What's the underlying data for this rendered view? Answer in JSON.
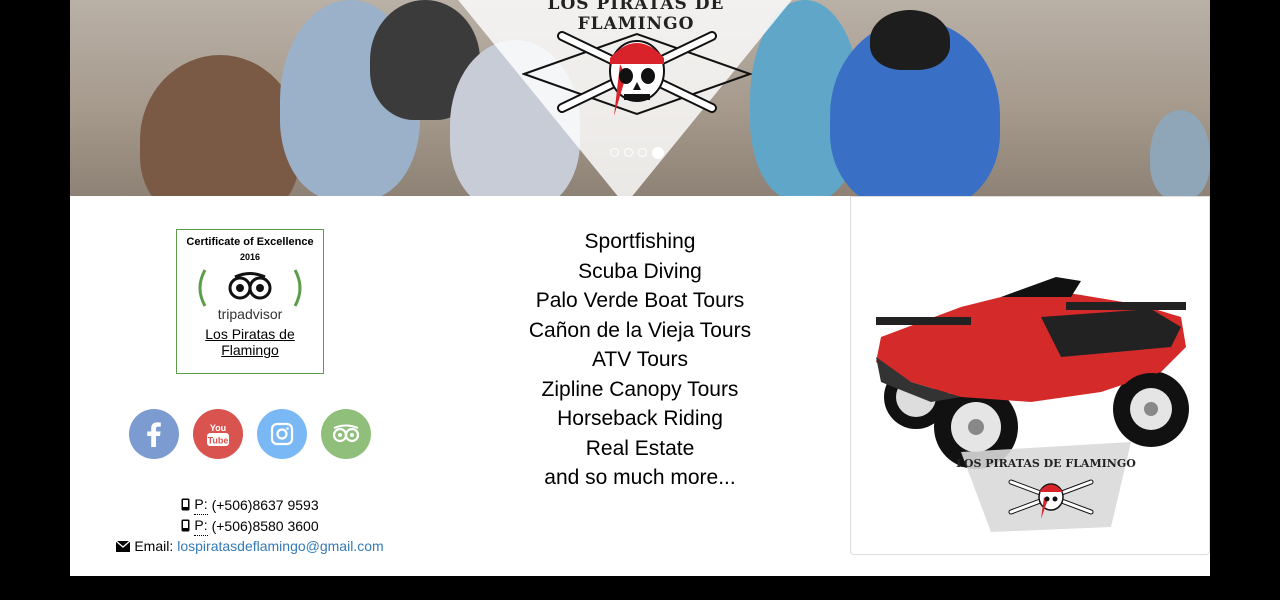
{
  "hero": {
    "brand": "LOS PIRATAS DE FLAMINGO",
    "slides": [
      "slide 1",
      "slide 2",
      "slide 3",
      "slide 4"
    ],
    "active_slide": 4
  },
  "certificate": {
    "title": "Certificate of Excellence",
    "year": "2016",
    "brand": "tripadvisor",
    "link_text": "Los Piratas de Flamingo"
  },
  "social": [
    {
      "name": "facebook-icon",
      "color": "#7b9bd1"
    },
    {
      "name": "youtube-icon",
      "color": "#d9534f"
    },
    {
      "name": "instagram-icon",
      "color": "#7ab8f5"
    },
    {
      "name": "tripadvisor-icon",
      "color": "#8fbf7a"
    }
  ],
  "contact": {
    "phone1_label": "P:",
    "phone1": "(+506)8637 9593",
    "phone2_label": "P:",
    "phone2": "(+506)8580 3600",
    "email_label": "Email:",
    "email": "lospiratasdeflamingo@gmail.com"
  },
  "services": [
    "Sportfishing",
    "Scuba Diving",
    "Palo Verde Boat Tours",
    "Cañon de la Vieja Tours",
    "ATV Tours",
    "Zipline Canopy Tours",
    "Horseback Riding",
    "Real Estate",
    "and so much more..."
  ],
  "atv_panel": {
    "brand": "LOS PIRATAS DE FLAMINGO"
  }
}
